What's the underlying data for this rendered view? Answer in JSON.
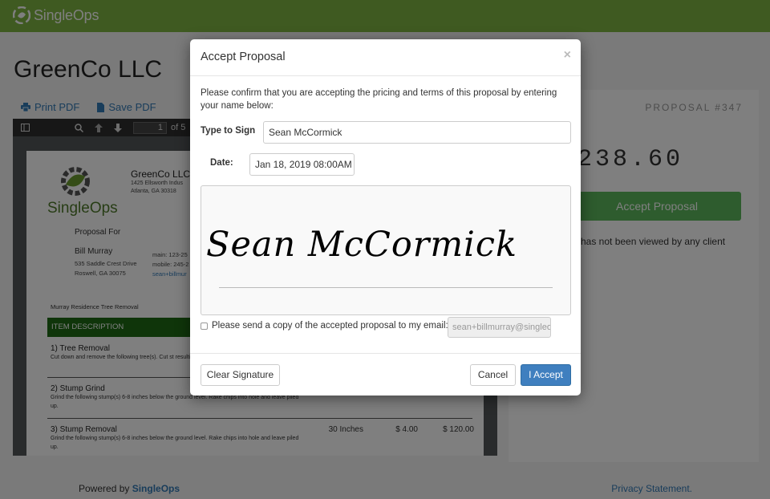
{
  "app": {
    "brand": "SingleOps"
  },
  "page": {
    "company_title": "GreenCo LLC",
    "print_pdf": "Print PDF",
    "save_pdf": "Save PDF"
  },
  "pdf_viewer": {
    "page_number": "1",
    "page_total": "of 5",
    "document": {
      "logo_text": "SingleOps",
      "company_name": "GreenCo LLC",
      "company_address": [
        "1425 Ellsworth Indus",
        "Atlanta, GA 30318"
      ],
      "proposal_for": "Proposal For",
      "client_name": "Bill Murray",
      "client_address": [
        "535 Saddle Crest Drive",
        "Roswell, GA 30075"
      ],
      "client_contact": [
        "main: 123-25",
        "mobile: 245-2",
        "sean+billmur"
      ],
      "job_name": "Murray Residence Tree Removal",
      "item_header": "ITEM DESCRIPTION",
      "items": [
        {
          "title": "1) Tree Removal",
          "desc": "Cut down and remove the following tree(s). Cut st resulting debris."
        },
        {
          "title": "2) Stump Grind",
          "desc": "Grind the following stump(s) 6-8 inches below the ground level. Rake chips into hole and leave piled up."
        },
        {
          "title": "3) Stump Removal",
          "desc": "Grind the following stump(s) 6-8 inches below the ground level. Rake chips into hole and leave piled up.",
          "qty": "30 Inches",
          "rate": "$ 4.00",
          "total": "$ 120.00"
        }
      ]
    }
  },
  "right_panel": {
    "proposal_number": "PROPOSAL #347",
    "amount": "238.60",
    "accept_button": "Accept Proposal",
    "view_status": "has not been viewed by any client"
  },
  "footer": {
    "powered_by": "Powered by",
    "powered_brand": "SingleOps",
    "privacy": "Privacy Statement."
  },
  "modal": {
    "title": "Accept Proposal",
    "close": "×",
    "confirm_text": "Please confirm that you are accepting the pricing and terms of this proposal by entering your name below:",
    "type_to_sign_label": "Type to Sign",
    "type_to_sign_value": "Sean McCormick",
    "date_label": "Date:",
    "date_value": "Jan 18, 2019 08:00AM",
    "signature_text": "Sean McCormick",
    "copy_label": "Please send a copy of the accepted proposal to my email:",
    "email_value": "sean+billmurray@singleo",
    "clear_signature": "Clear Signature",
    "cancel": "Cancel",
    "accept": "I Accept"
  },
  "colors": {
    "brand_green": "#7fb542",
    "primary_blue": "#3f7fbf",
    "success_green": "#5cb85c",
    "doc_header_green": "#1e6a14"
  }
}
